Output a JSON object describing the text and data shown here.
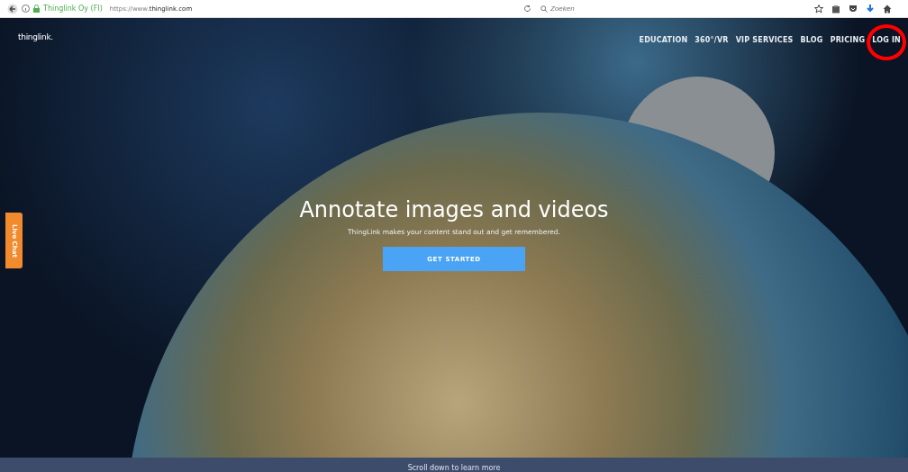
{
  "browser": {
    "site_identity": "Thinglink Oy (FI)",
    "url_prefix": "https://www.",
    "url_domain": "thinglink.com",
    "search": {
      "placeholder": "Zoeken"
    }
  },
  "header": {
    "logo": "thinglink.",
    "nav": [
      {
        "label": "EDUCATION"
      },
      {
        "label": "360°/VR"
      },
      {
        "label": "VIP SERVICES"
      },
      {
        "label": "BLOG"
      },
      {
        "label": "PRICING"
      },
      {
        "label": "LOG IN",
        "highlighted": true
      }
    ]
  },
  "hero": {
    "title": "Annotate images and videos",
    "subtitle": "ThingLink makes your content stand out and get remembered.",
    "button": "GET STARTED"
  },
  "live_chat": "Live Chat",
  "footer": {
    "text": "Scroll down to learn more"
  }
}
